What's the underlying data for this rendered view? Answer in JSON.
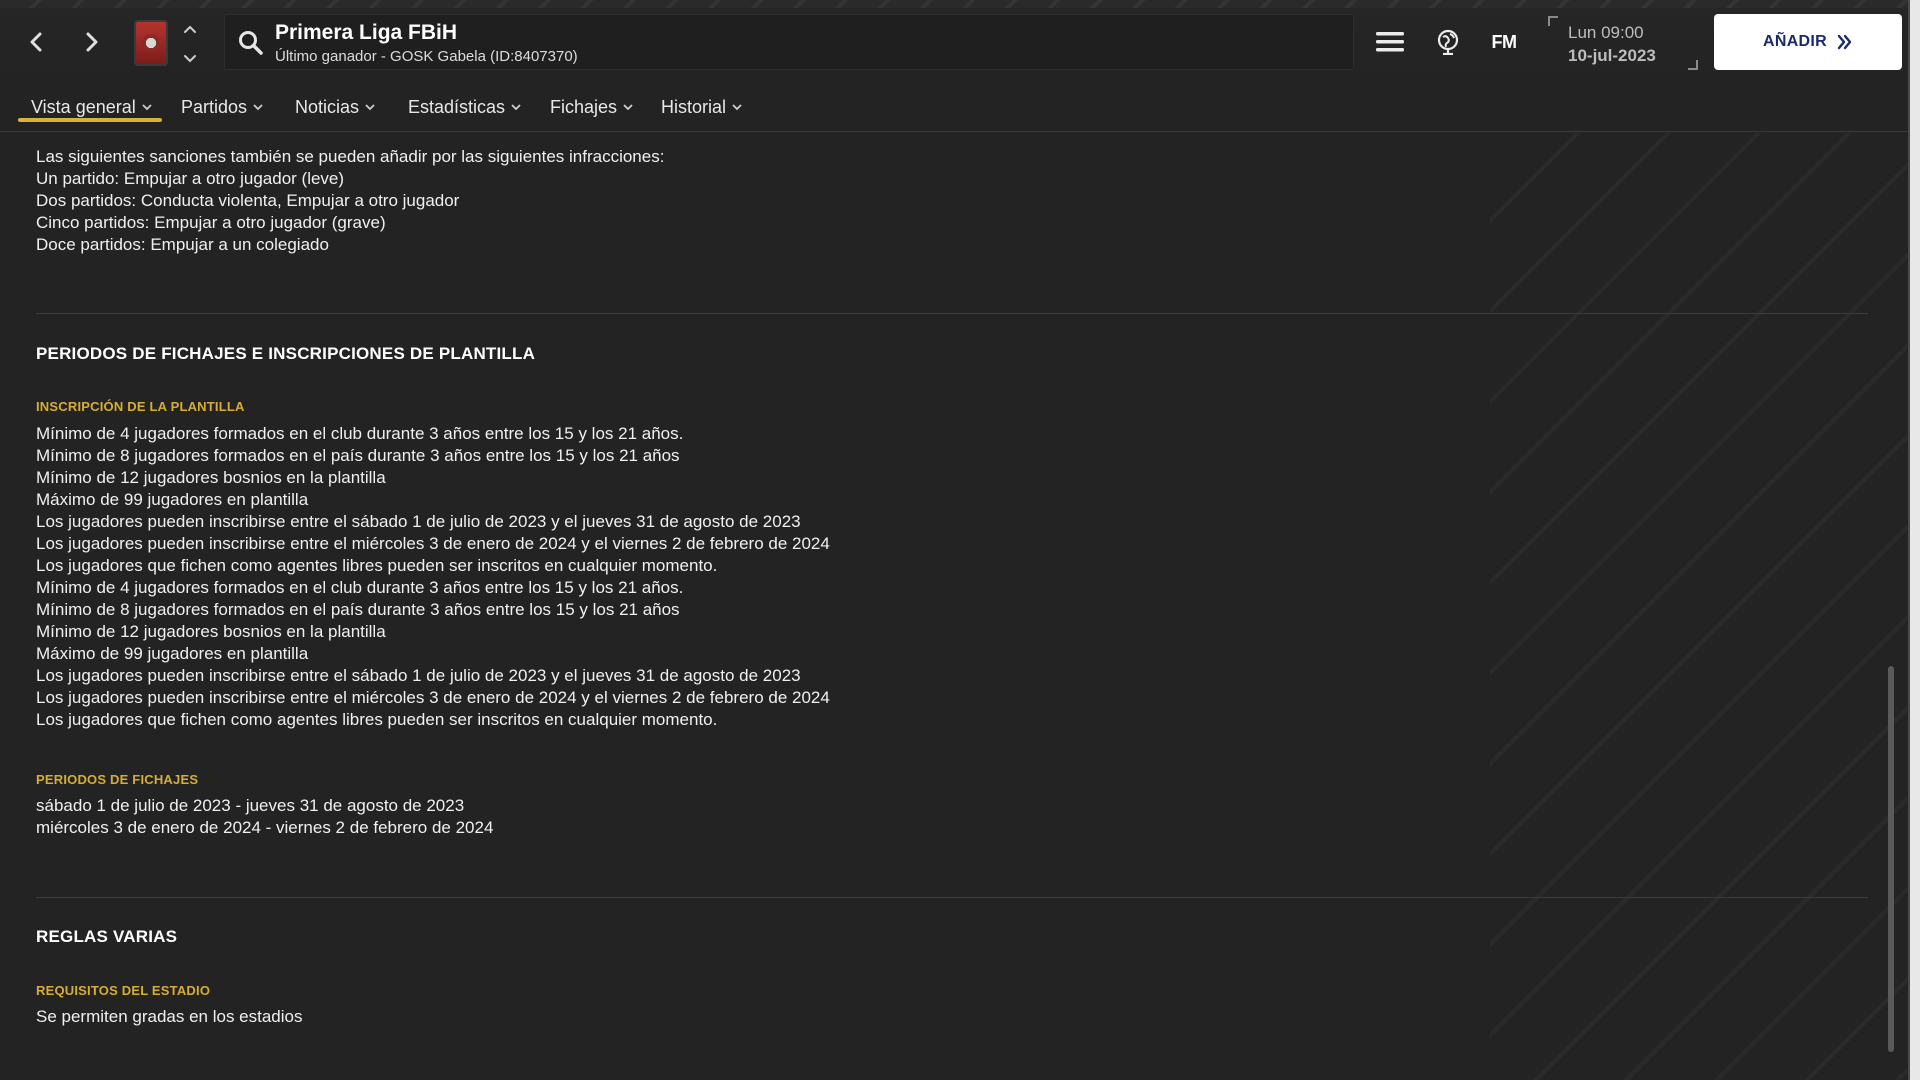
{
  "header": {
    "competition_title": "Primera Liga FBiH",
    "competition_subtitle": "Último ganador - GOSK Gabela (ID:8407370)",
    "fm_label": "FM",
    "time": "Lun 09:00",
    "date": "10-jul-2023",
    "add_button_label": "AÑADIR",
    "accent_color": "#d9b23a",
    "add_button_text_color": "#1b2a6b"
  },
  "tabs": [
    {
      "label": "Vista general",
      "active": true
    },
    {
      "label": "Partidos"
    },
    {
      "label": "Noticias"
    },
    {
      "label": "Estadísticas"
    },
    {
      "label": "Fichajes"
    },
    {
      "label": "Historial"
    }
  ],
  "sanctions": {
    "lines": [
      "Las siguientes sanciones también se pueden añadir por las siguientes infracciones:",
      "Un partido: Empujar a otro jugador (leve)",
      "Dos partidos: Conducta violenta, Empujar a otro jugador",
      "Cinco partidos: Empujar a otro jugador (grave)",
      "Doce partidos: Empujar a un colegiado"
    ]
  },
  "transfer_section": {
    "heading": "PERIODOS DE FICHAJES E INSCRIPCIONES DE PLANTILLA",
    "registration_heading": "INSCRIPCIÓN DE LA PLANTILLA",
    "registration_lines": [
      "Mínimo de 4 jugadores formados en el club durante 3 años entre los 15 y los 21 años.",
      "Mínimo de 8 jugadores formados en el país durante 3 años entre los 15 y los 21 años",
      "Mínimo de 12 jugadores bosnios en la plantilla",
      "Máximo de 99 jugadores en plantilla",
      "Los jugadores pueden inscribirse entre el sábado 1 de julio de 2023 y el jueves 31 de agosto de 2023",
      "Los jugadores pueden inscribirse entre el miércoles 3 de enero de 2024 y el viernes 2 de febrero de 2024",
      "Los jugadores que fichen como agentes libres pueden ser inscritos en cualquier momento.",
      "Mínimo de 4 jugadores formados en el club durante 3 años entre los 15 y los 21 años.",
      "Mínimo de 8 jugadores formados en el país durante 3 años entre los 15 y los 21 años",
      "Mínimo de 12 jugadores bosnios en la plantilla",
      "Máximo de 99 jugadores en plantilla",
      "Los jugadores pueden inscribirse entre el sábado 1 de julio de 2023 y el jueves 31 de agosto de 2023",
      "Los jugadores pueden inscribirse entre el miércoles 3 de enero de 2024 y el viernes 2 de febrero de 2024",
      "Los jugadores que fichen como agentes libres pueden ser inscritos en cualquier momento."
    ],
    "periods_heading": "PERIODOS DE FICHAJES",
    "periods_lines": [
      "sábado 1 de julio de 2023 - jueves 31 de agosto de 2023",
      "miércoles 3 de enero de 2024 - viernes 2 de febrero de 2024"
    ]
  },
  "misc_section": {
    "heading": "REGLAS VARIAS",
    "stadium_heading": "REQUISITOS DEL ESTADIO",
    "stadium_lines": [
      "Se permiten gradas en los estadios"
    ]
  }
}
